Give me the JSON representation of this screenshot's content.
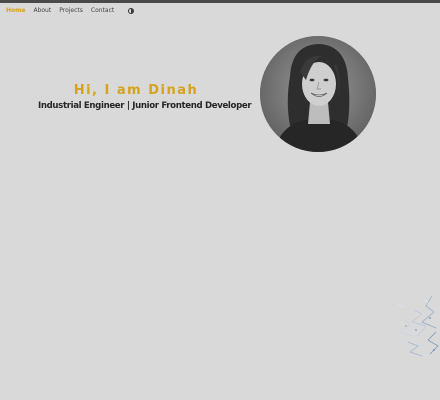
{
  "nav": {
    "home": "Home",
    "about": "About",
    "projects": "Projects",
    "contact": "Contact",
    "theme_icon": "theme-toggle-icon"
  },
  "hero": {
    "greeting": "Hi, I am Dinah",
    "subtitle": "Industrial Engineer | Junior Frontend Developer",
    "avatar_icon": "profile-photo"
  },
  "colors": {
    "background": "#d9d9d9",
    "accent": "#d6a21a",
    "text": "#262626"
  }
}
